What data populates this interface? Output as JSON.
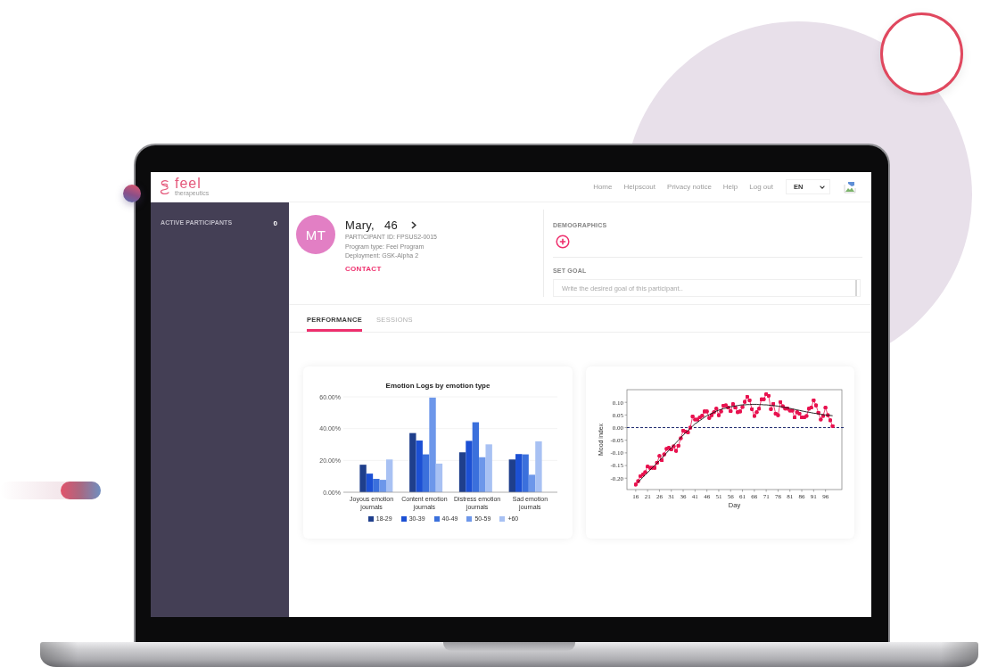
{
  "logo": {
    "name": "feel",
    "tagline": "therapeutics"
  },
  "nav": {
    "links": [
      "Home",
      "Helpscout",
      "Privacy notice",
      "Help",
      "Log out"
    ],
    "language": "EN"
  },
  "sidebar": {
    "title": "ACTIVE PARTICIPANTS",
    "count": "0"
  },
  "participant": {
    "initials": "MT",
    "name": "Mary,",
    "age": "46",
    "info": [
      "PARTICIPANT ID: FPSUS2-0015",
      "Program type: Feel Program",
      "Deployment: GSK-Alpha 2"
    ],
    "contact": "CONTACT"
  },
  "demographics": {
    "label": "DEMOGRAPHICS"
  },
  "goal": {
    "label": "SET GOAL",
    "placeholder": "Write the desired goal of this participant.."
  },
  "tabs": [
    {
      "label": "PERFORMANCE",
      "selected": true
    },
    {
      "label": "SESSIONS",
      "selected": false
    }
  ],
  "charts": [
    {
      "chart_data": {
        "type": "bar",
        "title": "Emotion Logs by emotion type",
        "categories": [
          "Joyous emotion journals",
          "Content emotion journals",
          "Distress emotion journals",
          "Sad emotion journals"
        ],
        "series": [
          {
            "name": "18-29",
            "color": "#1f3f8c",
            "values": [
              17.3,
              37.2,
              25.1,
              20.6
            ]
          },
          {
            "name": "30-39",
            "color": "#1c50d4",
            "values": [
              11.7,
              32.5,
              32.3,
              24
            ]
          },
          {
            "name": "40-49",
            "color": "#3b70dc",
            "values": [
              8.4,
              23.8,
              44,
              23.8
            ]
          },
          {
            "name": "50-59",
            "color": "#6d97ea",
            "values": [
              7.8,
              59.5,
              22,
              11
            ]
          },
          {
            "name": "+60",
            "color": "#a8c1f3",
            "values": [
              20.6,
              18,
              30.1,
              32
            ]
          }
        ],
        "ylim": [
          0,
          60
        ],
        "yticks": [
          {
            "value": 0,
            "label": "0.00%"
          },
          {
            "value": 20,
            "label": "20.00%"
          },
          {
            "value": 40,
            "label": "40.00%"
          },
          {
            "value": 60,
            "label": "60.00%"
          }
        ],
        "legend": "bottom"
      }
    },
    {
      "chart_data": {
        "type": "line",
        "xlabel": "Day",
        "ylabel": "Mood index",
        "x": [
          16,
          17,
          18,
          19,
          20,
          21,
          22,
          23,
          24,
          25,
          26,
          27,
          28,
          29,
          30,
          31,
          32,
          33,
          34,
          35,
          36,
          37,
          38,
          39,
          40,
          41,
          42,
          43,
          44,
          45,
          46,
          47,
          48,
          49,
          50,
          51,
          52,
          53,
          54,
          55,
          56,
          57,
          58,
          59,
          60,
          61,
          62,
          63,
          64,
          65,
          66,
          67,
          68,
          69,
          70,
          71,
          72,
          73,
          74,
          75,
          76,
          77,
          78,
          79,
          80,
          81,
          82,
          83,
          84,
          85,
          86,
          87,
          88,
          89,
          90,
          91,
          92,
          93,
          94,
          95,
          96,
          97,
          98,
          99
        ],
        "series": [
          {
            "color": "#e8124f",
            "values": [
              -0.225,
              -0.212,
              -0.192,
              -0.186,
              -0.176,
              -0.154,
              -0.159,
              -0.159,
              -0.159,
              -0.139,
              -0.112,
              -0.129,
              -0.106,
              -0.084,
              -0.08,
              -0.086,
              -0.074,
              -0.092,
              -0.072,
              -0.042,
              -0.012,
              -0.016,
              -0.019,
              0,
              0.044,
              0.032,
              0.032,
              0.04,
              0.047,
              0.064,
              0.064,
              0.038,
              0.049,
              0.061,
              0.075,
              0.049,
              0.064,
              0.087,
              0.088,
              0.079,
              0.065,
              0.093,
              0.079,
              0.061,
              0.064,
              0.081,
              0.102,
              0.122,
              0.108,
              0.073,
              0.046,
              0.061,
              0.075,
              0.112,
              0.112,
              0.132,
              0.126,
              0.073,
              0.094,
              0.055,
              0.049,
              0.101,
              0.085,
              0.075,
              0.075,
              0.067,
              0.067,
              0.04,
              0.061,
              0.055,
              0.04,
              0.04,
              0.046,
              0.075,
              0.079,
              0.108,
              0.088,
              0.059,
              0.032,
              0.046,
              0.079,
              0.049,
              0.029,
              0.006
            ]
          },
          {
            "marker": "none",
            "color": "#111111",
            "values": [
              null,
              -0.216,
              -0.206,
              -0.197,
              -0.187,
              -0.178,
              -0.168,
              -0.159,
              -0.149,
              -0.14,
              -0.13,
              -0.12,
              -0.11,
              -0.1,
              -0.09,
              -0.08,
              -0.07,
              -0.06,
              -0.05,
              -0.04,
              -0.03,
              -0.021,
              null,
              -0.003,
              0.006,
              0.015,
              0.021,
              0.028,
              0.034,
              0.041,
              0.047,
              0.051,
              0.056,
              0.06,
              0.065,
              0.069,
              0.072,
              0.075,
              0.077,
              0.08,
              0.083,
              0.084,
              0.086,
              0.087,
              0.089,
              0.09,
              0.09,
              0.091,
              0.091,
              0.092,
              0.092,
              0.092,
              0.091,
              0.091,
              0.09,
              0.09,
              0.089,
              0.088,
              0.087,
              0.086,
              0.085,
              0.083,
              0.081,
              0.08,
              0.078,
              0.076,
              0.074,
              0.072,
              0.07,
              0.068,
              0.066,
              0.064,
              0.062,
              0.061,
              0.059,
              0.057,
              0.056,
              0.054,
              0.053,
              0.051,
              0.05,
              0.049,
              0.048,
              0.047
            ]
          }
        ],
        "xlim": [
          12.3,
          102.9
        ],
        "ylim": [
          -0.245,
          0.15
        ],
        "xticks": [
          16,
          21,
          26,
          31,
          36,
          41,
          46,
          51,
          56,
          61,
          66,
          71,
          76,
          81,
          86,
          91,
          96
        ],
        "yticks": [
          {
            "value": -0.2,
            "label": "-0.20"
          },
          {
            "value": -0.15,
            "label": "-0.15"
          },
          {
            "value": -0.1,
            "label": "-0.10"
          },
          {
            "value": -0.05,
            "label": "-0.05"
          },
          {
            "value": 0,
            "label": "0.00"
          },
          {
            "value": 0.05,
            "label": "0.05"
          },
          {
            "value": 0.1,
            "label": "0.10"
          }
        ],
        "ref_lines": [
          {
            "axis": "y",
            "value": 0,
            "color": "#1e2a6e"
          }
        ]
      }
    }
  ]
}
